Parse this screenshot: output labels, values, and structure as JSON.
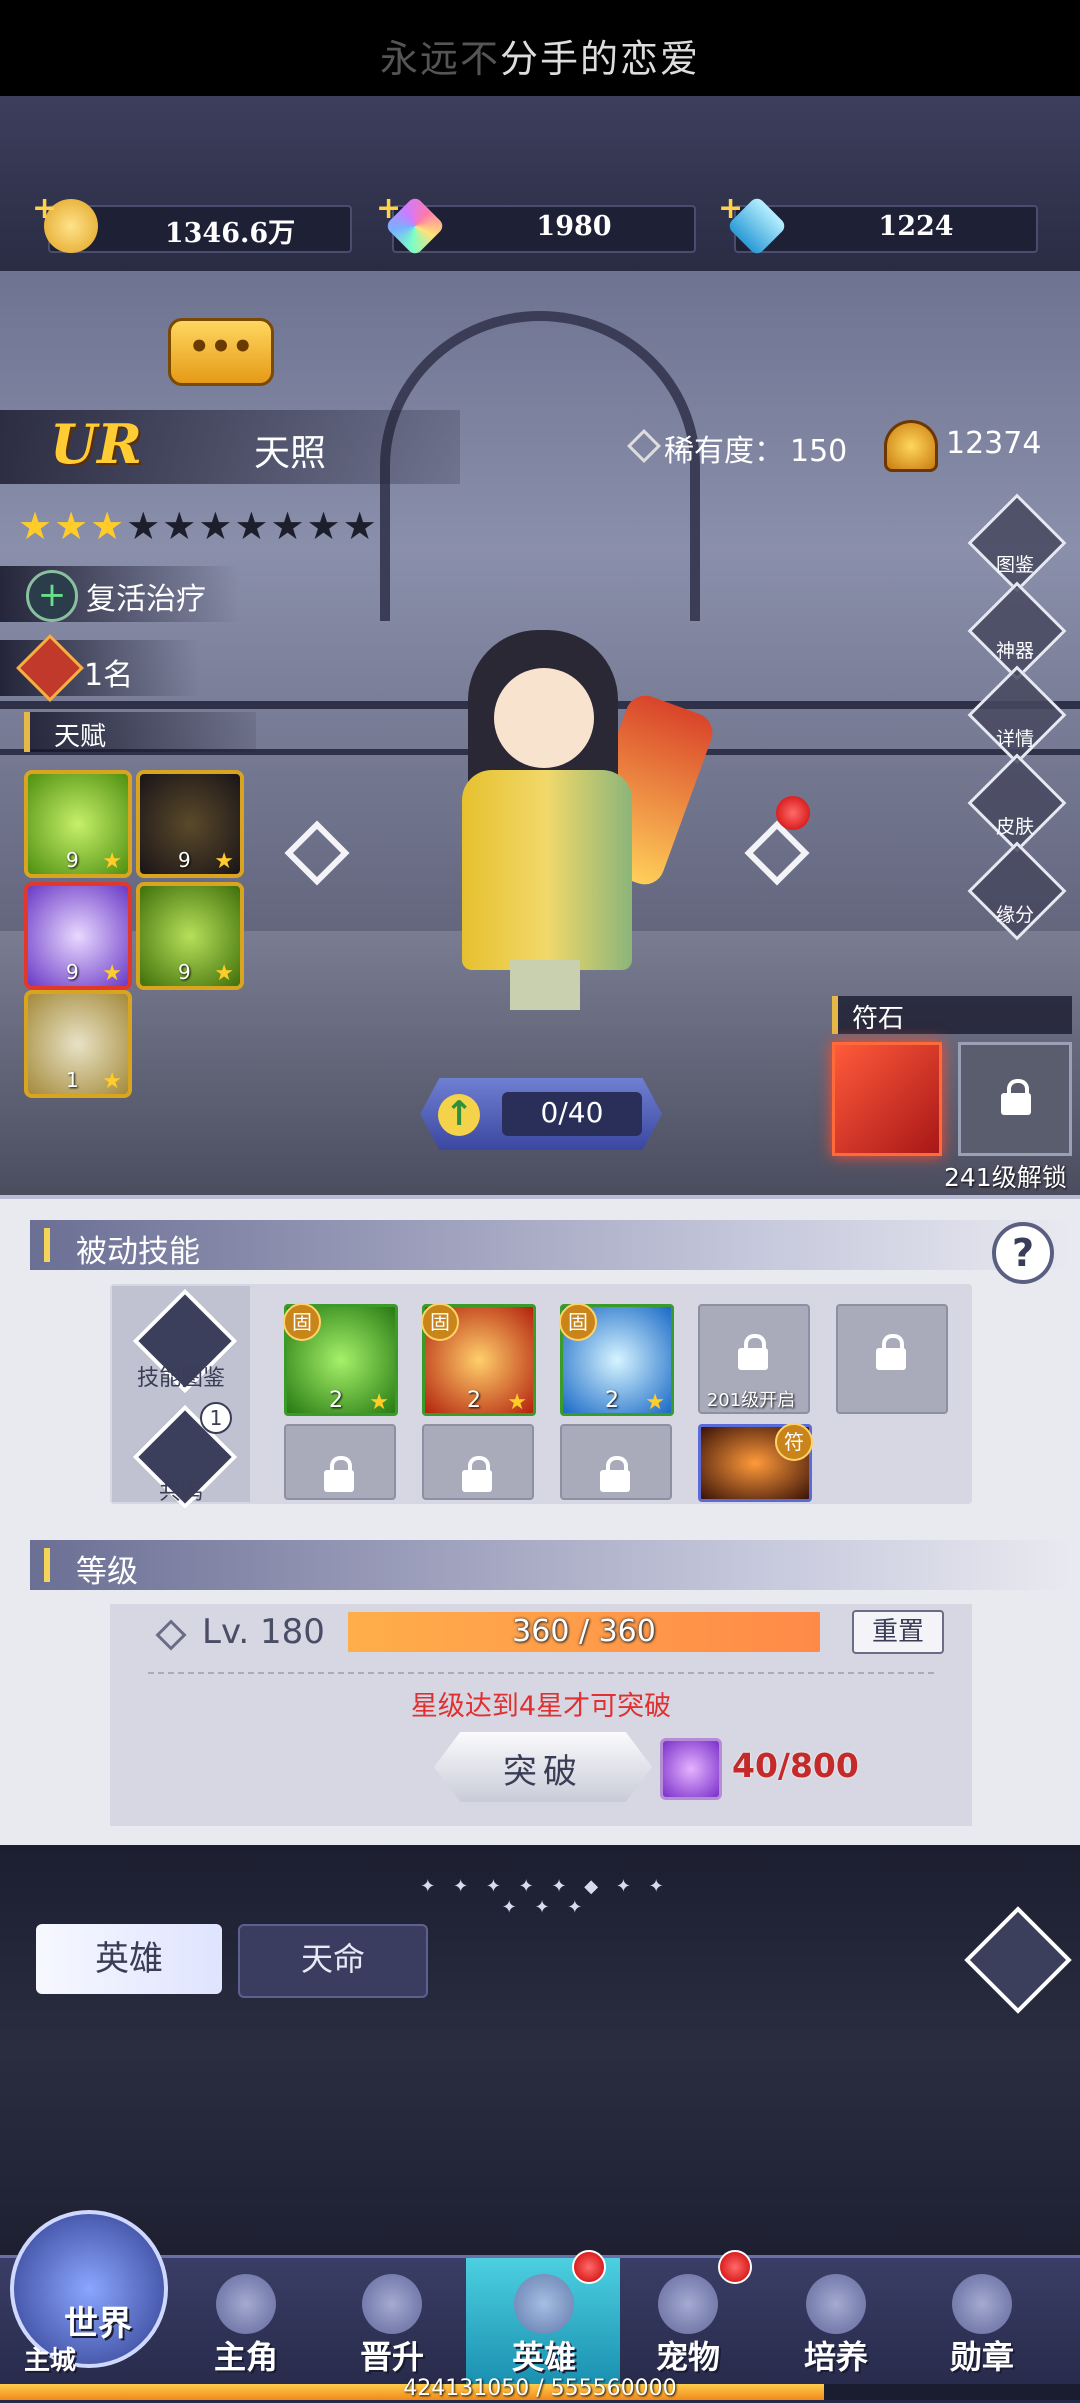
{
  "top_bar": {
    "song_dim": "永远不",
    "song_bright": "分手的恋爱"
  },
  "currency": [
    {
      "icon": "gold-coin-icon",
      "value": "1346.6万"
    },
    {
      "icon": "rainbow-gem-icon",
      "value": "1980"
    },
    {
      "icon": "blue-diamond-icon",
      "value": "1224"
    }
  ],
  "hero": {
    "grade": "UR",
    "name": "天照",
    "rarity_label": "稀有度：",
    "rarity_value": "150",
    "power": "12374",
    "stars_lit": 3,
    "stars_total": 10,
    "stars_on": "★★★",
    "stars_off": "★★★★★★★",
    "role": "复活治疗",
    "rank": "1名",
    "talent_title": "天赋",
    "talents": [
      {
        "icon": "green-vortex-icon",
        "level": "9",
        "color": "#7fbf2a"
      },
      {
        "icon": "shadow-figure-icon",
        "level": "9",
        "color": "#2a2030"
      },
      {
        "icon": "purple-wave-icon",
        "level": "9",
        "color": "#7a5ad6"
      },
      {
        "icon": "green-dragon-icon",
        "level": "9",
        "color": "#5a9a1a"
      },
      {
        "icon": "white-hood-icon",
        "level": "1",
        "color": "#b9a77a"
      }
    ],
    "side_menu": [
      {
        "icon": "book-icon",
        "label": "图鉴"
      },
      {
        "icon": "artifact-icon",
        "label": "神器"
      },
      {
        "icon": "magnifier-icon",
        "label": "详情"
      },
      {
        "icon": "outfit-icon",
        "label": "皮肤"
      },
      {
        "icon": "heart-icon",
        "label": "缘分"
      }
    ],
    "exp": "0/40",
    "rune_title": "符石",
    "rune_unlock": "241级解锁"
  },
  "passive": {
    "title": "被动技能",
    "help": "?",
    "codex_label": "技能图鉴",
    "resonance_label": "共鸣",
    "resonance_badge": "1",
    "badge_text": "固",
    "badge_text_special": "符",
    "skills_row1": [
      {
        "icon": "bamboo-leaf-icon",
        "level": "2",
        "color": "#3a9a2a",
        "locked": false
      },
      {
        "icon": "fire-sword-icon",
        "level": "2",
        "color": "#c93a1a",
        "locked": false
      },
      {
        "icon": "ice-arrow-icon",
        "level": "2",
        "color": "#2a8ad6",
        "locked": false
      }
    ],
    "lock_201": "201级开启"
  },
  "level": {
    "title": "等级",
    "lv": "Lv. 180",
    "progress_text": "360 / 360",
    "progress_fraction": 1.0,
    "reset": "重置",
    "warning": "星级达到4星才可突破",
    "break_label": "突破",
    "orb_count": "40/800"
  },
  "divider": "✦ ✦ ✦ ✦ ✦ ◆ ✦ ✦ ✦ ✦ ✦",
  "tabs": {
    "hero": "英雄",
    "fate": "天命"
  },
  "world": {
    "world": "世界",
    "city": "主城"
  },
  "nav": [
    {
      "icon": "protagonist-icon",
      "label": "主角",
      "dot": false
    },
    {
      "icon": "promote-icon",
      "label": "晋升",
      "dot": false
    },
    {
      "icon": "helmet-icon",
      "label": "英雄",
      "dot": true,
      "active": true
    },
    {
      "icon": "pet-icon",
      "label": "宠物",
      "dot": true
    },
    {
      "icon": "cultivate-icon",
      "label": "培养",
      "dot": false
    },
    {
      "icon": "medal-icon",
      "label": "勋章",
      "dot": false
    }
  ],
  "account_exp": {
    "text": "424131050 / 555560000",
    "fraction": 0.763
  }
}
